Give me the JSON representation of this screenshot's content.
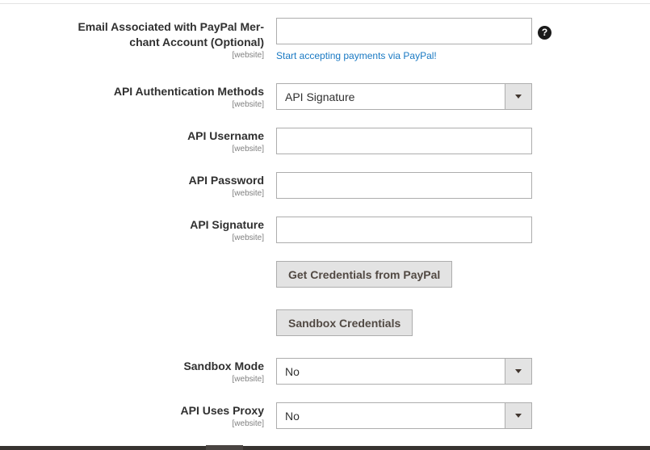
{
  "fields": {
    "email": {
      "label": "Email Associated with PayPal Merchant Account (Optional)",
      "label_line1": "Email Associated with PayPal Mer-",
      "label_line2": "chant Account (Optional)",
      "scope": "[website]",
      "value": "",
      "note_link": "Start accepting payments via PayPal!",
      "help_icon": "question-circle-icon",
      "help_glyph": "?"
    },
    "auth_methods": {
      "label": "API Authentication Methods",
      "scope": "[website]",
      "selected": "API Signature"
    },
    "api_username": {
      "label": "API Username",
      "scope": "[website]",
      "value": ""
    },
    "api_password": {
      "label": "API Password",
      "scope": "[website]",
      "value": ""
    },
    "api_signature": {
      "label": "API Signature",
      "scope": "[website]",
      "value": ""
    },
    "sandbox_mode": {
      "label": "Sandbox Mode",
      "scope": "[website]",
      "selected": "No"
    },
    "api_proxy": {
      "label": "API Uses Proxy",
      "scope": "[website]",
      "selected": "No"
    }
  },
  "buttons": {
    "get_credentials": "Get Credentials from PayPal",
    "sandbox_credentials": "Sandbox Credentials"
  },
  "icons": {
    "dropdown": "chevron-down-icon"
  },
  "colors": {
    "link": "#1979c3",
    "button_bg": "#e3e3e3",
    "border": "#adadad",
    "footer": "#373330"
  }
}
